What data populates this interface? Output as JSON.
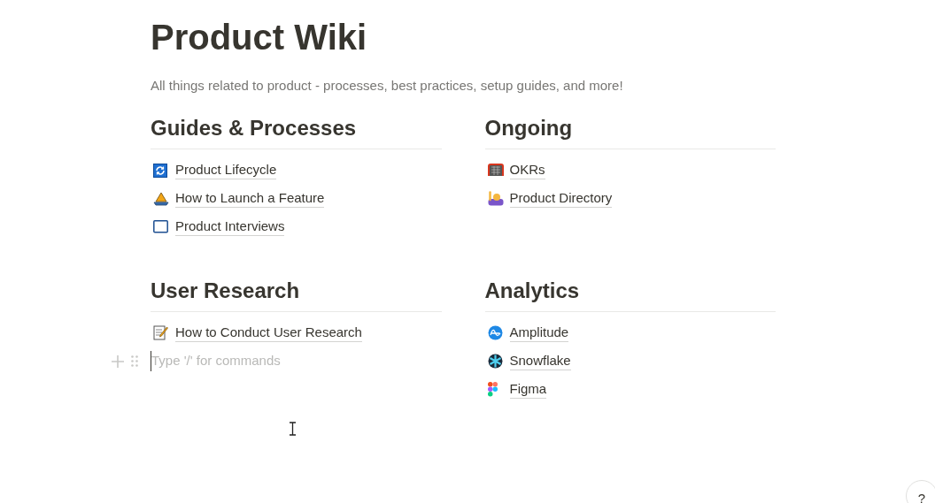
{
  "title": "Product Wiki",
  "description": "All things related to product - processes, best practices, setup guides, and more!",
  "sections": [
    {
      "heading": "Guides & Processes",
      "links": [
        "Product Lifecycle",
        "How to Launch a Feature",
        "Product Interviews"
      ]
    },
    {
      "heading": "Ongoing",
      "links": [
        "OKRs",
        "Product Directory"
      ]
    },
    {
      "heading": "User Research",
      "links": [
        "How to Conduct User Research"
      ]
    },
    {
      "heading": "Analytics",
      "links": [
        "Amplitude",
        "Snowflake",
        "Figma"
      ]
    }
  ],
  "new_block": {
    "placeholder": "Type '/' for commands"
  },
  "help_button": "?"
}
